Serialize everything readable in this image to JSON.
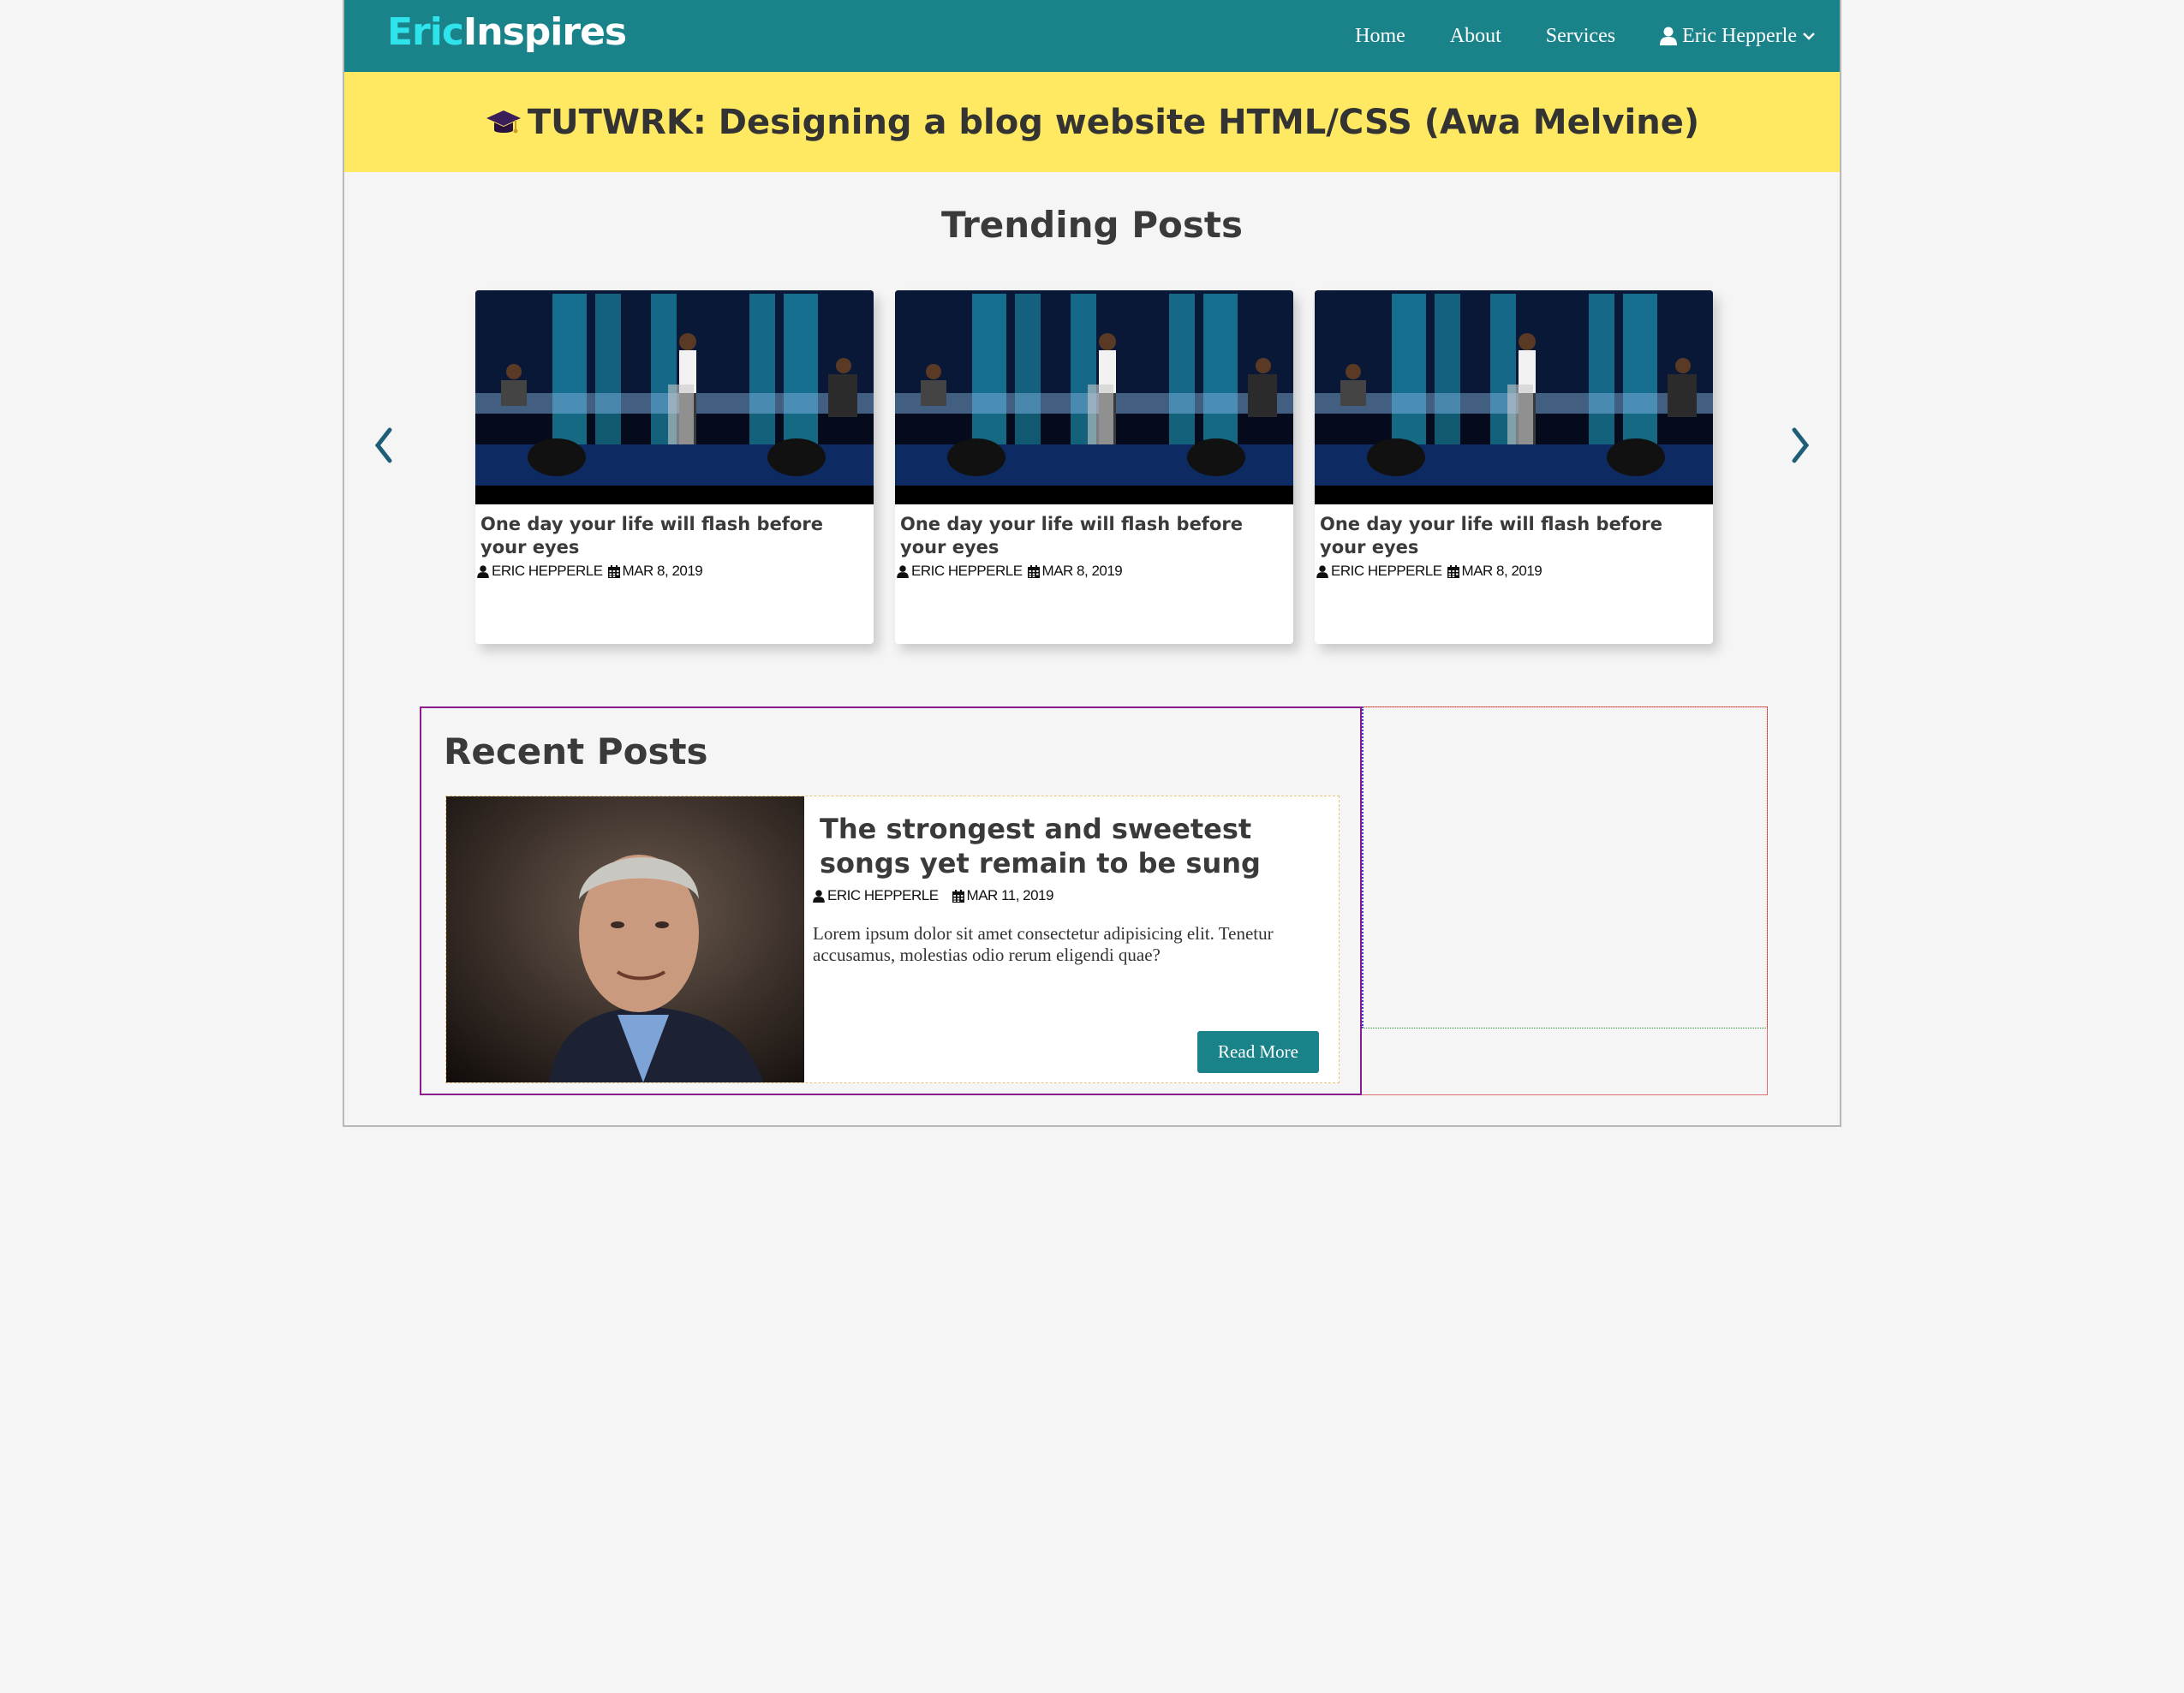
{
  "navbar": {
    "brand_part1": "Eric",
    "brand_part2": "Inspires",
    "links": [
      "Home",
      "About",
      "Services"
    ],
    "user_name": "Eric Hepperle",
    "brand_color": "#1a8389",
    "accent_color": "#2ee3ea"
  },
  "banner": {
    "title": "TUTWRK: Designing a blog website HTML/CSS (Awa Melvine)",
    "icon": "graduation-cap-icon",
    "background": "#ffe862"
  },
  "trending": {
    "title": "Trending Posts",
    "cards": [
      {
        "title": "One day your life will flash before your eyes",
        "author": "ERIC HEPPERLE",
        "date": "MAR 8, 2019"
      },
      {
        "title": "One day your life will flash before your eyes",
        "author": "ERIC HEPPERLE",
        "date": "MAR 8, 2019"
      },
      {
        "title": "One day your life will flash before your eyes",
        "author": "ERIC HEPPERLE",
        "date": "MAR 8, 2019"
      }
    ]
  },
  "recent": {
    "title": "Recent Posts",
    "post": {
      "title": "The strongest and sweetest songs yet remain to be sung",
      "author": "ERIC HEPPERLE",
      "date": "MAR 11, 2019",
      "excerpt": "Lorem ipsum dolor sit amet consectetur adipisicing elit. Tenetur accusamus, molestias odio rerum eligendi quae?",
      "button": "Read More"
    }
  }
}
